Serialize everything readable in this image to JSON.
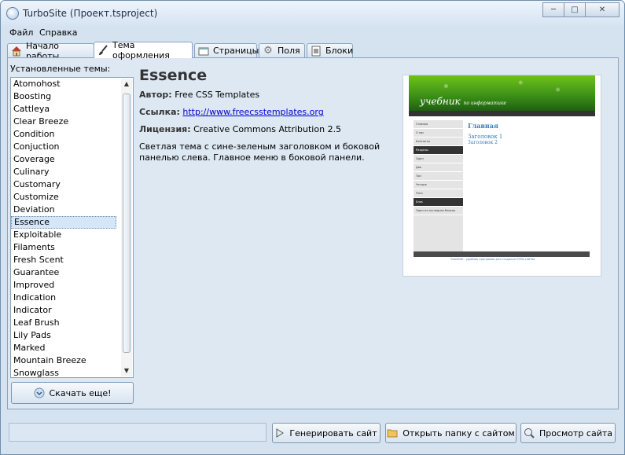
{
  "window": {
    "title": "TurboSite (Проект.tsproject)"
  },
  "menu": [
    "Файл",
    "Справка"
  ],
  "tabs": [
    {
      "label": "Начало работы",
      "icon": "home-icon"
    },
    {
      "label": "Тема оформления",
      "icon": "brush-icon",
      "active": true
    },
    {
      "label": "Страницы",
      "icon": "pages-icon"
    },
    {
      "label": "Поля",
      "icon": "gear-icon"
    },
    {
      "label": "Блоки",
      "icon": "blocks-icon"
    }
  ],
  "themes": {
    "label": "Установленные темы:",
    "items": [
      "Atomohost",
      "Boosting",
      "Cattleya",
      "Clear Breeze",
      "Condition",
      "Conjuction",
      "Coverage",
      "Culinary",
      "Customary",
      "Customize",
      "Deviation",
      "Essence",
      "Exploitable",
      "Filaments",
      "Fresh Scent",
      "Guarantee",
      "Improved",
      "Indication",
      "Indicator",
      "Leaf Brush",
      "Lily Pads",
      "Marked",
      "Mountain Breeze",
      "Snowglass"
    ],
    "selected": "Essence",
    "download_label": "Скачать еще!"
  },
  "details": {
    "name": "Essence",
    "author_label": "Автор:",
    "author": "Free CSS Templates",
    "link_label": "Ссылка:",
    "link": "http://www.freecsstemplates.org",
    "license_label": "Лицензия:",
    "license": "Creative Commons Attribution 2.5",
    "description": "Светлая тема с сине-зеленым заголовком и боковой панелью слева. Главное меню в боковой панели."
  },
  "preview": {
    "logo": "учебник",
    "logo_sub": "по информатике",
    "nav": [
      "Главная",
      "О нас",
      "Контакты",
      "Разделы",
      "Один",
      "Два",
      "Три",
      "Четыре",
      "Пять",
      "Блок",
      "Один из последних блоков"
    ],
    "h1": "Главная",
    "h2": "Заголовок 1",
    "h3": "Заголовок 2",
    "footer_link": "TurboSite - удобная программа для создания HTML-сайтов"
  },
  "buttons": {
    "generate": "Генерировать сайт",
    "open_folder": "Открыть папку с сайтом",
    "view_site": "Просмотр сайта"
  }
}
